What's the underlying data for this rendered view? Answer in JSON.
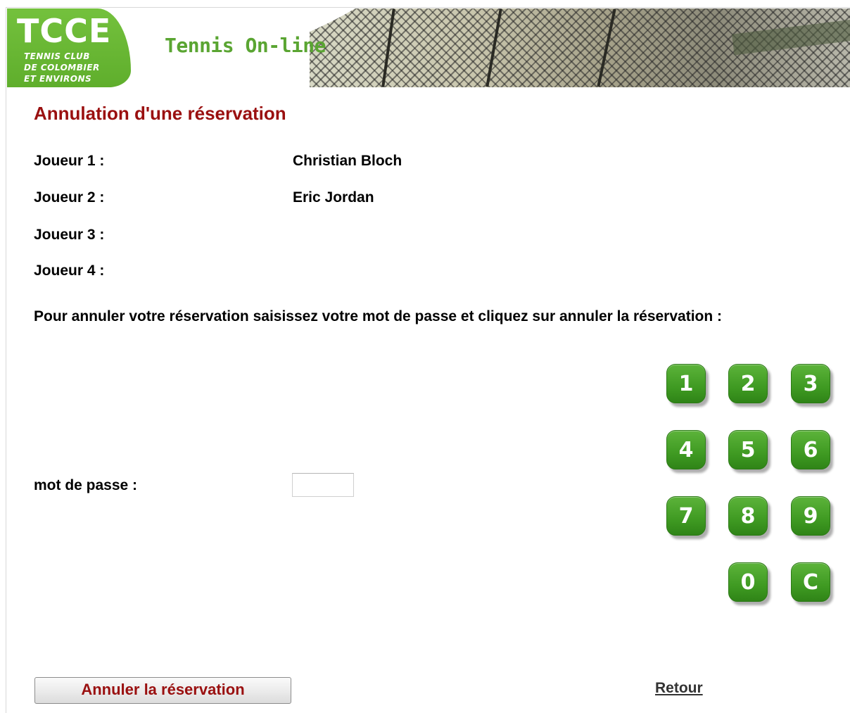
{
  "header": {
    "logo_text": "TCCE",
    "logo_subtitle": [
      "TENNIS CLUB",
      "DE COLOMBIER",
      "ET ENVIRONS"
    ],
    "app_title": "Tennis On-line"
  },
  "page": {
    "title": "Annulation d'une réservation"
  },
  "players": [
    {
      "label": "Joueur 1 :",
      "name": "Christian Bloch"
    },
    {
      "label": "Joueur 2 :",
      "name": "Eric Jordan"
    },
    {
      "label": "Joueur 3 :",
      "name": ""
    },
    {
      "label": "Joueur 4 :",
      "name": ""
    }
  ],
  "instruction": "Pour annuler votre réservation saisissez votre mot de passe et cliquez sur annuler la réservation :",
  "password": {
    "label": "mot de passe :",
    "value": ""
  },
  "keypad": {
    "keys": [
      "1",
      "2",
      "3",
      "4",
      "5",
      "6",
      "7",
      "8",
      "9",
      "0",
      "C"
    ]
  },
  "actions": {
    "cancel_label": "Annuler la réservation",
    "back_label": "Retour"
  },
  "colors": {
    "title_red": "#9a1010",
    "brand_green": "#5aa532",
    "key_green": "#3f9a22"
  }
}
